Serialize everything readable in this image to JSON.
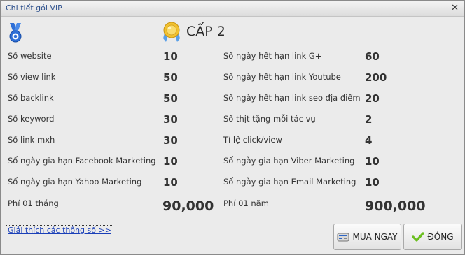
{
  "window": {
    "title": "Chi tiết gói VIP",
    "close_glyph": "✕"
  },
  "header": {
    "level_text": "CẤP 2",
    "medal_icon": "medal-icon",
    "badge_icon": "gold-badge-icon"
  },
  "left_rows": [
    {
      "label": "Số website",
      "value": "10"
    },
    {
      "label": "Số view link",
      "value": "50"
    },
    {
      "label": "Số backlink",
      "value": "50"
    },
    {
      "label": "Số keyword",
      "value": "30"
    },
    {
      "label": "Số link mxh",
      "value": "30"
    },
    {
      "label": "Số ngày gia hạn Facebook Marketing",
      "value": "10"
    },
    {
      "label": "Số ngày gia hạn Yahoo Marketing",
      "value": "10"
    }
  ],
  "right_rows": [
    {
      "label": "Số ngày hết hạn link G+",
      "value": "60"
    },
    {
      "label": "Số ngày hết hạn link Youtube",
      "value": "200"
    },
    {
      "label": "Số ngày hết hạn link seo địa điểm",
      "value": "20"
    },
    {
      "label": "Số thịt tặng mỗi tác vụ",
      "value": "2"
    },
    {
      "label": "Tỉ lệ click/view",
      "value": "4"
    },
    {
      "label": "Số ngày gia hạn Viber Marketing",
      "value": "10"
    },
    {
      "label": "Số ngày gia hạn Email Marketing",
      "value": "10"
    }
  ],
  "fees": {
    "monthly_label": "Phí 01 tháng",
    "monthly_value": "90,000",
    "yearly_label": "Phí 01 năm",
    "yearly_value": "900,000"
  },
  "footer": {
    "explain_link": "Giải thích các thông số >>",
    "buy_label": "MUA NGAY",
    "close_label": "ĐÓNG"
  }
}
